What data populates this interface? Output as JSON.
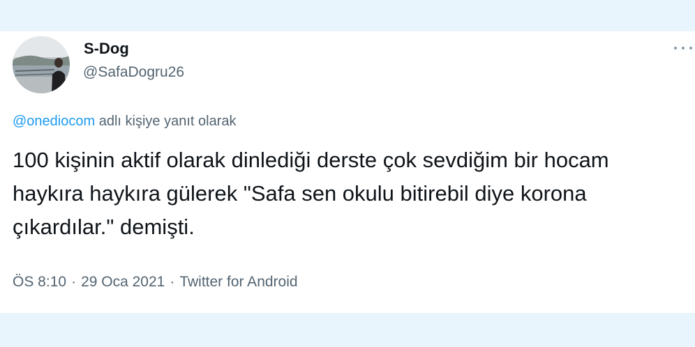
{
  "user": {
    "display_name": "S-Dog",
    "handle": "@SafaDogru26"
  },
  "reply": {
    "mention": "@onediocom",
    "suffix": "adlı kişiye yanıt olarak"
  },
  "tweet": {
    "text": "100 kişinin aktif olarak dinlediği derste çok sevdiğim bir hocam haykıra haykıra gülerek \"Safa sen okulu bitirebil diye korona çıkardılar.\" demişti."
  },
  "meta": {
    "time": "ÖS 8:10",
    "separator": "·",
    "date": "29 Oca 2021",
    "source": "Twitter for Android"
  },
  "icons": {
    "more": "more-horizontal-icon",
    "avatar": "profile-photo"
  },
  "colors": {
    "link": "#1d9bf0",
    "secondary_text": "#536471",
    "primary_text": "#0f1419",
    "background_band": "#e8f5fd"
  }
}
